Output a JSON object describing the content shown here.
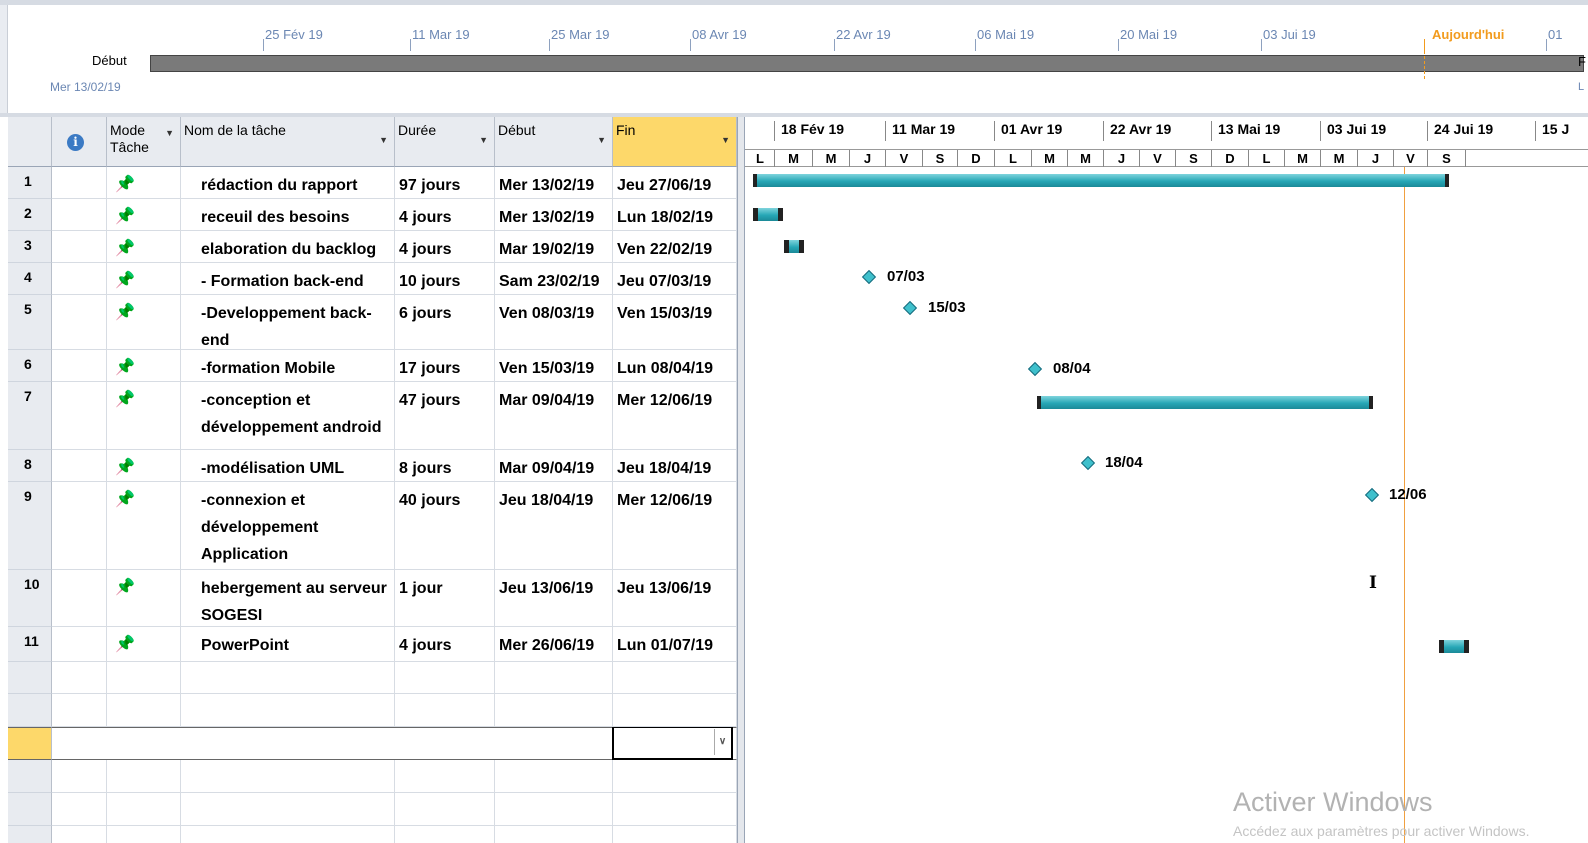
{
  "timeline": {
    "dates": [
      "25 Fév 19",
      "11 Mar 19",
      "25 Mar 19",
      "08 Avr 19",
      "22 Avr 19",
      "06 Mai 19",
      "20 Mai 19",
      "03 Jui 19"
    ],
    "today_label": "Aujourd'hui",
    "end_partial": "01",
    "start_label": "Début",
    "start_date": "Mer 13/02/19",
    "end_letter": "F",
    "end_letter2": "L"
  },
  "columns": {
    "mode": "Mode Tâche",
    "name": "Nom de la tâche",
    "duration": "Durée",
    "start": "Début",
    "finish": "Fin"
  },
  "tasks": [
    {
      "id": "1",
      "name": "rédaction du rapport",
      "duration": "97 jours",
      "start": "Mer 13/02/19",
      "finish": "Jeu 27/06/19"
    },
    {
      "id": "2",
      "name": "receuil des besoins",
      "duration": "4 jours",
      "start": "Mer 13/02/19",
      "finish": "Lun 18/02/19"
    },
    {
      "id": "3",
      "name": "elaboration du backlog",
      "duration": "4 jours",
      "start": "Mar 19/02/19",
      "finish": "Ven 22/02/19"
    },
    {
      "id": "4",
      "name": "- Formation back-end",
      "duration": "10 jours",
      "start": "Sam 23/02/19",
      "finish": "Jeu 07/03/19"
    },
    {
      "id": "5",
      "name": "-Developpement back-end",
      "duration": "6 jours",
      "start": "Ven 08/03/19",
      "finish": "Ven 15/03/19"
    },
    {
      "id": "6",
      "name": "-formation Mobile",
      "duration": "17 jours",
      "start": "Ven 15/03/19",
      "finish": "Lun 08/04/19"
    },
    {
      "id": "7",
      "name": "-conception et développement android",
      "duration": "47 jours",
      "start": "Mar 09/04/19",
      "finish": "Mer 12/06/19"
    },
    {
      "id": "8",
      "name": "-modélisation UML",
      "duration": "8 jours",
      "start": "Mar 09/04/19",
      "finish": "Jeu 18/04/19"
    },
    {
      "id": "9",
      "name": "-connexion et développement Application",
      "duration": "40 jours",
      "start": "Jeu 18/04/19",
      "finish": "Mer 12/06/19"
    },
    {
      "id": "10",
      "name": "hebergement au serveur SOGESI",
      "duration": "1 jour",
      "start": "Jeu 13/06/19",
      "finish": "Jeu 13/06/19"
    },
    {
      "id": "11",
      "name": "PowerPoint",
      "duration": "4 jours",
      "start": "Mer 26/06/19",
      "finish": "Lun 01/07/19"
    }
  ],
  "gantt": {
    "weeks": [
      "18 Fév 19",
      "11 Mar 19",
      "01 Avr 19",
      "22 Avr 19",
      "13 Mai 19",
      "03 Jui 19",
      "24 Jui 19",
      "15 J"
    ],
    "days": [
      "L",
      "M",
      "M",
      "J",
      "V",
      "S",
      "D",
      "L",
      "M",
      "M",
      "J",
      "V",
      "S",
      "D",
      "L",
      "M",
      "M",
      "J",
      "V",
      "S"
    ],
    "milestones": {
      "m4": "07/03",
      "m5": "15/03",
      "m6": "08/04",
      "m8": "18/04",
      "m9": "12/06"
    }
  },
  "watermark": {
    "line1": "Activer Windows",
    "line2": "Accédez aux paramètres pour activer Windows."
  },
  "colors": {
    "accent": "#27a7b6",
    "today": "#f29b1d",
    "header_selected": "#fdd86a"
  }
}
